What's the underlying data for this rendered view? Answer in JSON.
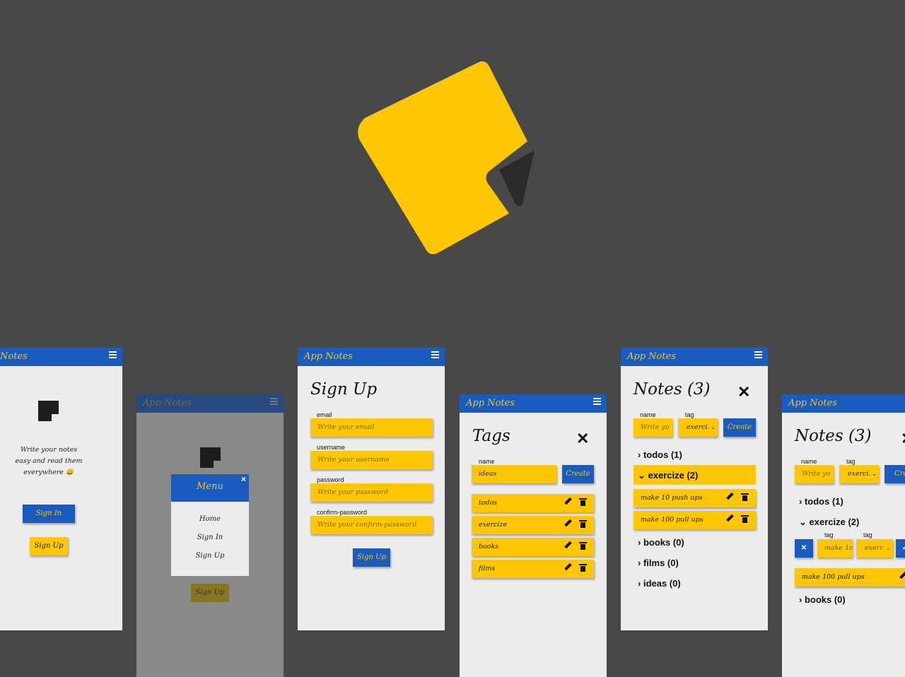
{
  "app_title": "App Notes",
  "app_title_cut": "Notes",
  "colors": {
    "background": "#484848",
    "accent": "#fec603",
    "primary": "#1a5bbf",
    "screen": "#ececec",
    "logo_flap": "#2b2b2b"
  },
  "intro": {
    "tagline": [
      "Write your notes",
      "easy and read them",
      "everywhere 😀"
    ],
    "signin_label": "Sign In",
    "signup_label": "Sign Up"
  },
  "menu": {
    "header": "Menu",
    "close_label": "×",
    "items": [
      "Home",
      "Sign In",
      "Sign Up"
    ],
    "under_button": "Sign Up"
  },
  "signup": {
    "title": "Sign Up",
    "fields": [
      {
        "label": "email",
        "placeholder": "Write your email"
      },
      {
        "label": "username",
        "placeholder": "Write your username"
      },
      {
        "label": "password",
        "placeholder": "Write your password"
      },
      {
        "label": "confirm-password",
        "placeholder": "Write your confirm-password"
      }
    ],
    "submit_label": "Sign Up"
  },
  "tags": {
    "title": "Tags",
    "close_label": "✕",
    "name_label": "name",
    "name_value": "ideas",
    "create_label": "Create",
    "items": [
      "todos",
      "exercize",
      "books",
      "films"
    ]
  },
  "notes": {
    "title": "Notes (3)",
    "close_label": "✕",
    "name_label": "name",
    "tag_label": "tag",
    "name_placeholder": "Write yo",
    "tag_value": "exerci.",
    "create_label": "Create",
    "groups": [
      "todos (1)",
      "exercize (2)",
      "books (0)",
      "films (0)",
      "ideas (0)"
    ],
    "expanded_notes": [
      "make 10 push ups",
      "make 100 pull ups"
    ]
  },
  "notes_edit": {
    "title": "Notes (3)",
    "create_label": "Crea",
    "name_placeholder": "Write yo",
    "tag_value": "exerci.",
    "edit_tag_label": "tag",
    "edit_name_value": "make 1c",
    "edit_tag_value": "exerc",
    "groups": [
      "todos (1)",
      "exercize (2)",
      "books (0)"
    ],
    "expanded_notes": [
      "make 100 pull ups"
    ]
  }
}
